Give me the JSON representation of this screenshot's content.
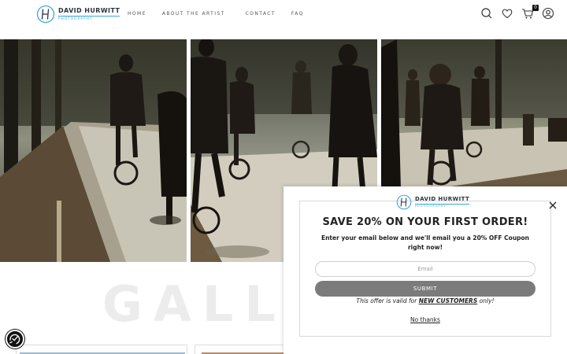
{
  "brand": {
    "name": "DAVID HURWITT",
    "tagline": "PHOTOGRAPHY",
    "accent_color": "#3aa9d6"
  },
  "nav": {
    "items": [
      {
        "label": "HOME"
      },
      {
        "label": "ABOUT THE ARTIST"
      },
      {
        "label": "CONTACT"
      },
      {
        "label": "FAQ"
      }
    ]
  },
  "header_icons": {
    "search": "search-icon",
    "wishlist": "heart-icon",
    "cart": "cart-icon",
    "account": "user-icon",
    "cart_count": "0"
  },
  "main": {
    "gallery_heading": "GALL"
  },
  "popup": {
    "title": "SAVE 20% ON YOUR FIRST ORDER!",
    "description": "Enter your email below and we'll email you a 20% OFF Coupon right now!",
    "email_placeholder": "Email",
    "submit_label": "SUBMIT",
    "offer_prefix": "This offer is valid for",
    "offer_highlight": "NEW CUSTOMERS",
    "offer_suffix": "only!",
    "dismiss_label": "No thanks",
    "submit_color": "#7b7b7b"
  },
  "accessibility": {
    "icon": "accessibility-icon"
  }
}
